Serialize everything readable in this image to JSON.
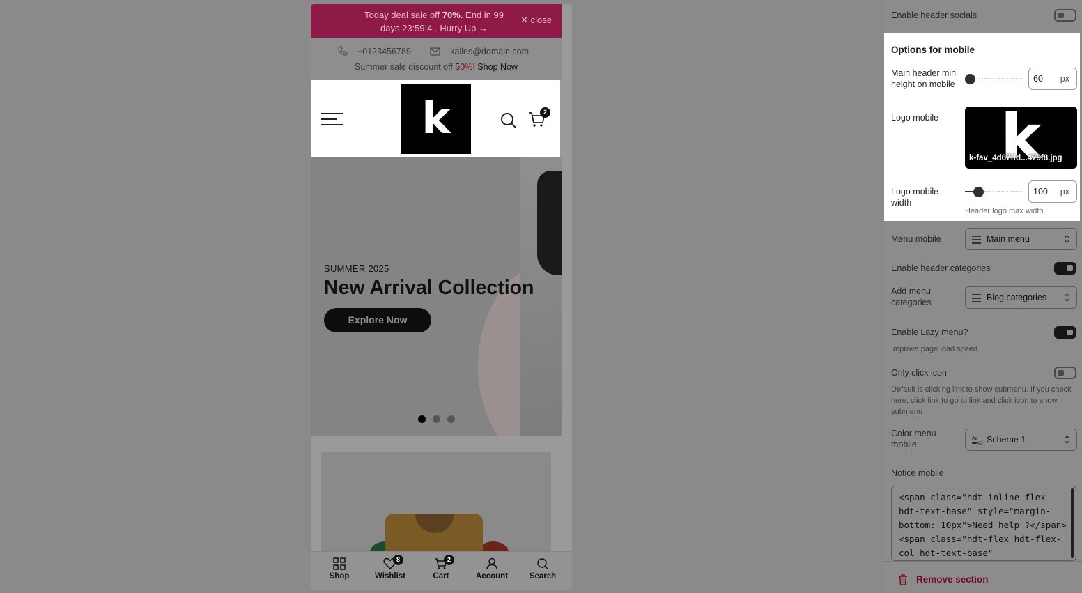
{
  "preview": {
    "announcement": {
      "text_pre": "Today deal sale off ",
      "discount": "70%.",
      "text_post": " End in 99 days 23:59:4",
      "hurry": ". Hurry Up →",
      "close": "close"
    },
    "contact": {
      "phone": "+0123456789",
      "email": "kalles@domain.com",
      "sale_pre": "Summer sale discount off ",
      "sale_value": "50%!",
      "shop_now": "Shop Now"
    },
    "header": {
      "logo_letter": "k",
      "cart_count": "2"
    },
    "hero": {
      "subtitle": "SUMMER 2025",
      "title": "New Arrival Collection",
      "button": "Explore Now",
      "slide_count": 3,
      "active_slide": 1
    },
    "bottom_nav": [
      {
        "label": "Shop",
        "icon": "grid-icon"
      },
      {
        "label": "Wishlist",
        "icon": "heart-icon",
        "badge": "8"
      },
      {
        "label": "Cart",
        "icon": "cart-icon",
        "badge": "2"
      },
      {
        "label": "Account",
        "icon": "user-icon"
      },
      {
        "label": "Search",
        "icon": "search-icon"
      }
    ]
  },
  "settings": {
    "header_socials": {
      "label": "Enable header socials",
      "enabled": false
    },
    "mobile_options": {
      "title": "Options for mobile",
      "min_height": {
        "label": "Main header min height on mobile",
        "value": "60",
        "unit": "px"
      },
      "logo": {
        "label": "Logo mobile",
        "filename": "k-fav_4d67ffd...479f8.jpg"
      },
      "logo_width": {
        "label": "Logo mobile width",
        "value": "100",
        "unit": "px",
        "help": "Header logo max width"
      }
    },
    "menu_mobile": {
      "label": "Menu mobile",
      "value": "Main menu"
    },
    "header_categories": {
      "label": "Enable header categories",
      "enabled": true
    },
    "menu_categories": {
      "label": "Add menu categories",
      "value": "Blog categories"
    },
    "lazy_menu": {
      "label": "Enable Lazy menu?",
      "enabled": true,
      "help": "Improve page load speed"
    },
    "only_click_icon": {
      "label": "Only click icon",
      "enabled": false,
      "help": "Default is clicking link to show submenu. If you check here, click link to go to link and click icon to show submenu"
    },
    "color_menu": {
      "label": "Color menu mobile",
      "value": "Scheme 1"
    },
    "notice_mobile": {
      "label": "Notice mobile",
      "value": "<span class=\"hdt-inline-flex hdt-text-base\" style=\"margin-bottom: 10px\">Need help ?</span><span class=\"hdt-flex hdt-flex-col hdt-text-base\""
    },
    "remove_section": "Remove section"
  },
  "colors": {
    "accent": "#8f1a48",
    "danger": "#6e0c20",
    "overlay": "#8a8a8a"
  }
}
